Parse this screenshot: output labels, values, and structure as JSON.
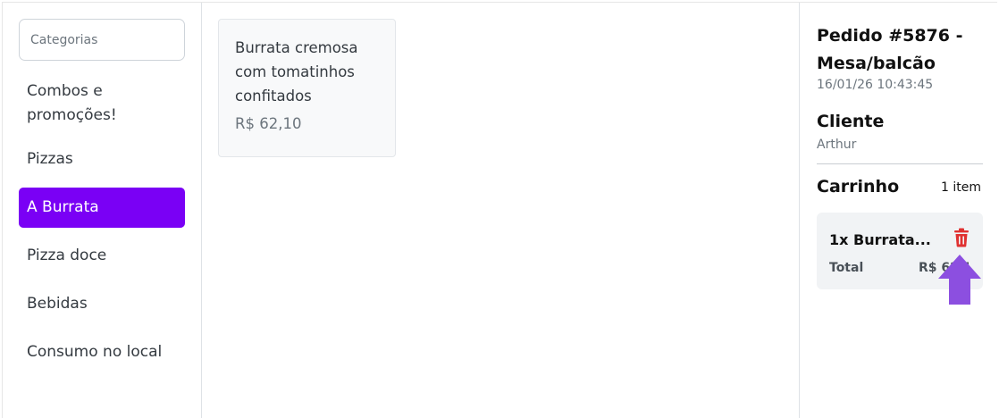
{
  "sidebar": {
    "search_placeholder": "Categorias",
    "items": [
      {
        "label": "Combos e promoções!"
      },
      {
        "label": "Pizzas"
      },
      {
        "label": "A Burrata",
        "active": true
      },
      {
        "label": "Pizza doce"
      },
      {
        "label": "Bebidas"
      },
      {
        "label": "Consumo no local"
      }
    ]
  },
  "products": [
    {
      "name": "Burrata cremosa com tomatinhos confitados",
      "price": "R$ 62,10"
    }
  ],
  "order": {
    "title": "Pedido #5876 - Mesa/balcão",
    "datetime": "16/01/26 10:43:45",
    "client_label": "Cliente",
    "client_name": "Arthur",
    "cart_label": "Carrinho",
    "cart_count": "1 item",
    "cart_item": "1x Burrata...",
    "total_label": "Total",
    "total_value": "R$ 62,10"
  },
  "colors": {
    "accent": "#7a00f5",
    "trash": "#e03131",
    "arrow": "#8c4fe0"
  },
  "icons": {
    "trash": "trash-icon",
    "arrow": "arrow-up-icon"
  }
}
